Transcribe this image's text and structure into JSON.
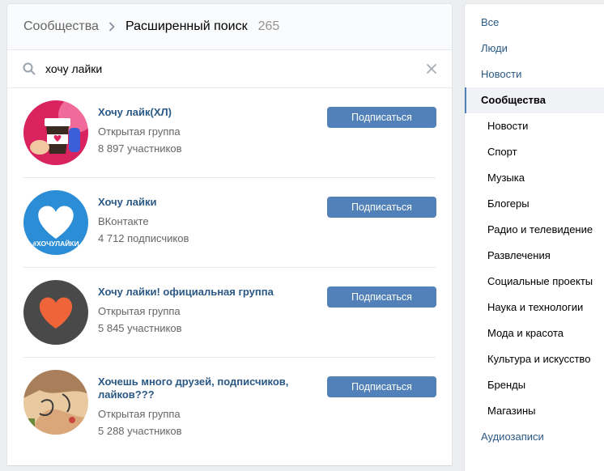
{
  "breadcrumb": {
    "parent": "Сообщества",
    "current": "Расширенный поиск",
    "count": "265"
  },
  "search": {
    "value": "хочу лайки"
  },
  "results": [
    {
      "name": "Хочу лайк(ХЛ)",
      "type": "Открытая группа",
      "members": "8 897 участников",
      "button": "Подписаться",
      "avatar": "coffee-cup-heart-avatar"
    },
    {
      "name": "Хочу лайки",
      "type": "ВКонтакте",
      "members": "4 712 подписчиков",
      "button": "Подписаться",
      "avatar": "white-heart-avatar",
      "avatar_text": "#ХОЧУЛАЙКИ"
    },
    {
      "name": "Хочу лайки! официальная группа",
      "type": "Открытая группа",
      "members": "5 845 участников",
      "button": "Подписаться",
      "avatar": "orange-heart-avatar"
    },
    {
      "name": "Хочешь много друзей, подписчиков, лайков???",
      "type": "Открытая группа",
      "members": "5 288 участников",
      "button": "Подписаться",
      "avatar": "tattoo-photo-avatar"
    }
  ],
  "sidebar": {
    "items": [
      {
        "label": "Все"
      },
      {
        "label": "Люди"
      },
      {
        "label": "Новости"
      },
      {
        "label": "Сообщества"
      },
      {
        "label": "Новости"
      },
      {
        "label": "Спорт"
      },
      {
        "label": "Музыка"
      },
      {
        "label": "Блогеры"
      },
      {
        "label": "Радио и телевидение"
      },
      {
        "label": "Развлечения"
      },
      {
        "label": "Социальные проекты"
      },
      {
        "label": "Наука и технологии"
      },
      {
        "label": "Мода и красота"
      },
      {
        "label": "Культура и искусство"
      },
      {
        "label": "Бренды"
      },
      {
        "label": "Магазины"
      },
      {
        "label": "Аудиозаписи"
      }
    ]
  },
  "colors": {
    "accent": "#5181b8",
    "link": "#2a5885",
    "page_bg": "#edeef0"
  }
}
